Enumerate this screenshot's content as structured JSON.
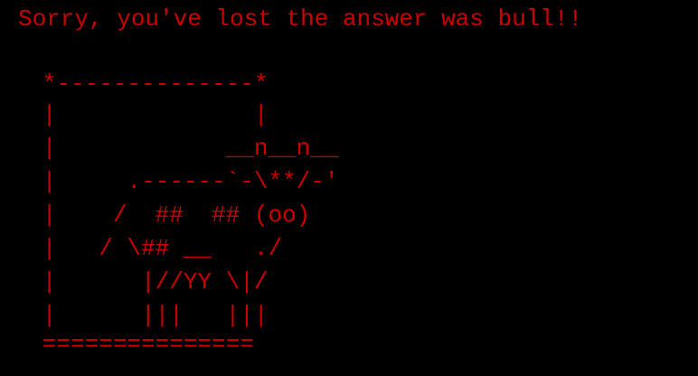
{
  "terminal": {
    "message": "Sorry, you've lost the answer was bull!!",
    "text_color": "#cc0000",
    "background_color": "#000000",
    "ascii_art": [
      "   *--------------*",
      "   |              |",
      "   |            __n__n__",
      "   |     .------`-\\**/-'",
      "   |    /  ##  ## (oo)",
      "   |   / \\## __   ./",
      "   |      |//YY \\|/",
      "   |      |||   |||",
      "   ==============="
    ]
  }
}
